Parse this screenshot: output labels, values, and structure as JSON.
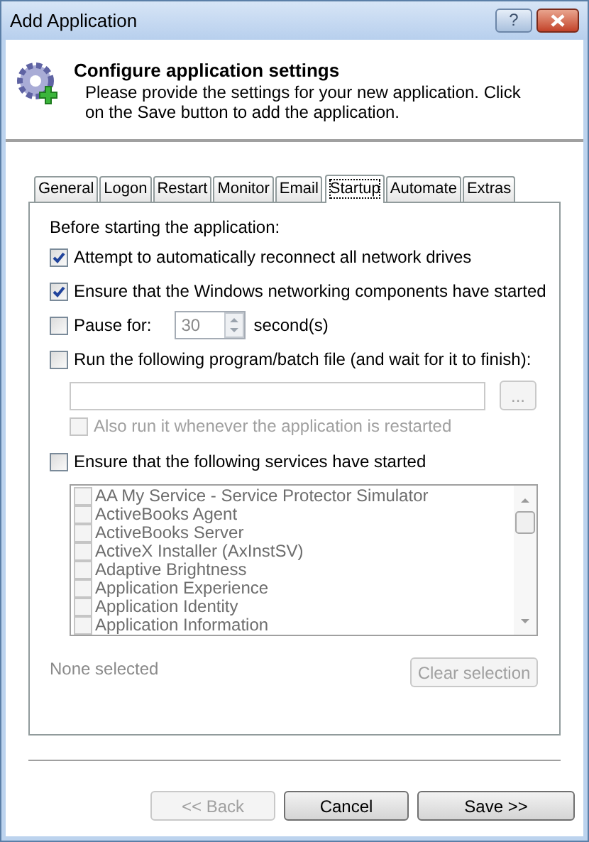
{
  "window": {
    "title": "Add Application",
    "help_button": "?"
  },
  "header": {
    "title": "Configure application settings",
    "description": "Please provide the settings for your new application. Click on the Save button to add the application."
  },
  "tabs": [
    {
      "label": "General",
      "selected": false
    },
    {
      "label": "Logon",
      "selected": false
    },
    {
      "label": "Restart",
      "selected": false
    },
    {
      "label": "Monitor",
      "selected": false
    },
    {
      "label": "Email",
      "selected": false
    },
    {
      "label": "Startup",
      "selected": true
    },
    {
      "label": "Automate",
      "selected": false
    },
    {
      "label": "Extras",
      "selected": false
    }
  ],
  "startup": {
    "heading": "Before starting the application:",
    "options": [
      {
        "kind": "checkbox",
        "label": "Attempt to automatically reconnect all network drives",
        "checked": true
      },
      {
        "kind": "checkbox",
        "label": "Ensure that the Windows networking components have started",
        "checked": true
      },
      {
        "kind": "pause",
        "label": "Pause for:",
        "checked": false,
        "value": "30",
        "unit": "second(s)"
      },
      {
        "kind": "program",
        "label": "Run the following program/batch file (and wait for it to finish):",
        "checked": false,
        "browse": "...",
        "sub_option": {
          "label": "Also run it whenever the application is restarted",
          "checked": false,
          "disabled": true
        }
      },
      {
        "kind": "services",
        "label": "Ensure that the following services have started",
        "checked": false,
        "services": [
          {
            "name": "AA My Service - Service Protector Simulator",
            "checked": false
          },
          {
            "name": "ActiveBooks Agent",
            "checked": false
          },
          {
            "name": "ActiveBooks Server",
            "checked": false
          },
          {
            "name": "ActiveX Installer (AxInstSV)",
            "checked": false
          },
          {
            "name": "Adaptive Brightness",
            "checked": false
          },
          {
            "name": "Application Experience",
            "checked": false
          },
          {
            "name": "Application Identity",
            "checked": false
          },
          {
            "name": "Application Information",
            "checked": false
          }
        ],
        "status": "None selected",
        "clear_button": "Clear selection"
      }
    ]
  },
  "buttons": [
    {
      "label": "<< Back",
      "disabled": true
    },
    {
      "label": "Cancel",
      "disabled": false
    },
    {
      "label": "Save >>",
      "disabled": false
    }
  ]
}
